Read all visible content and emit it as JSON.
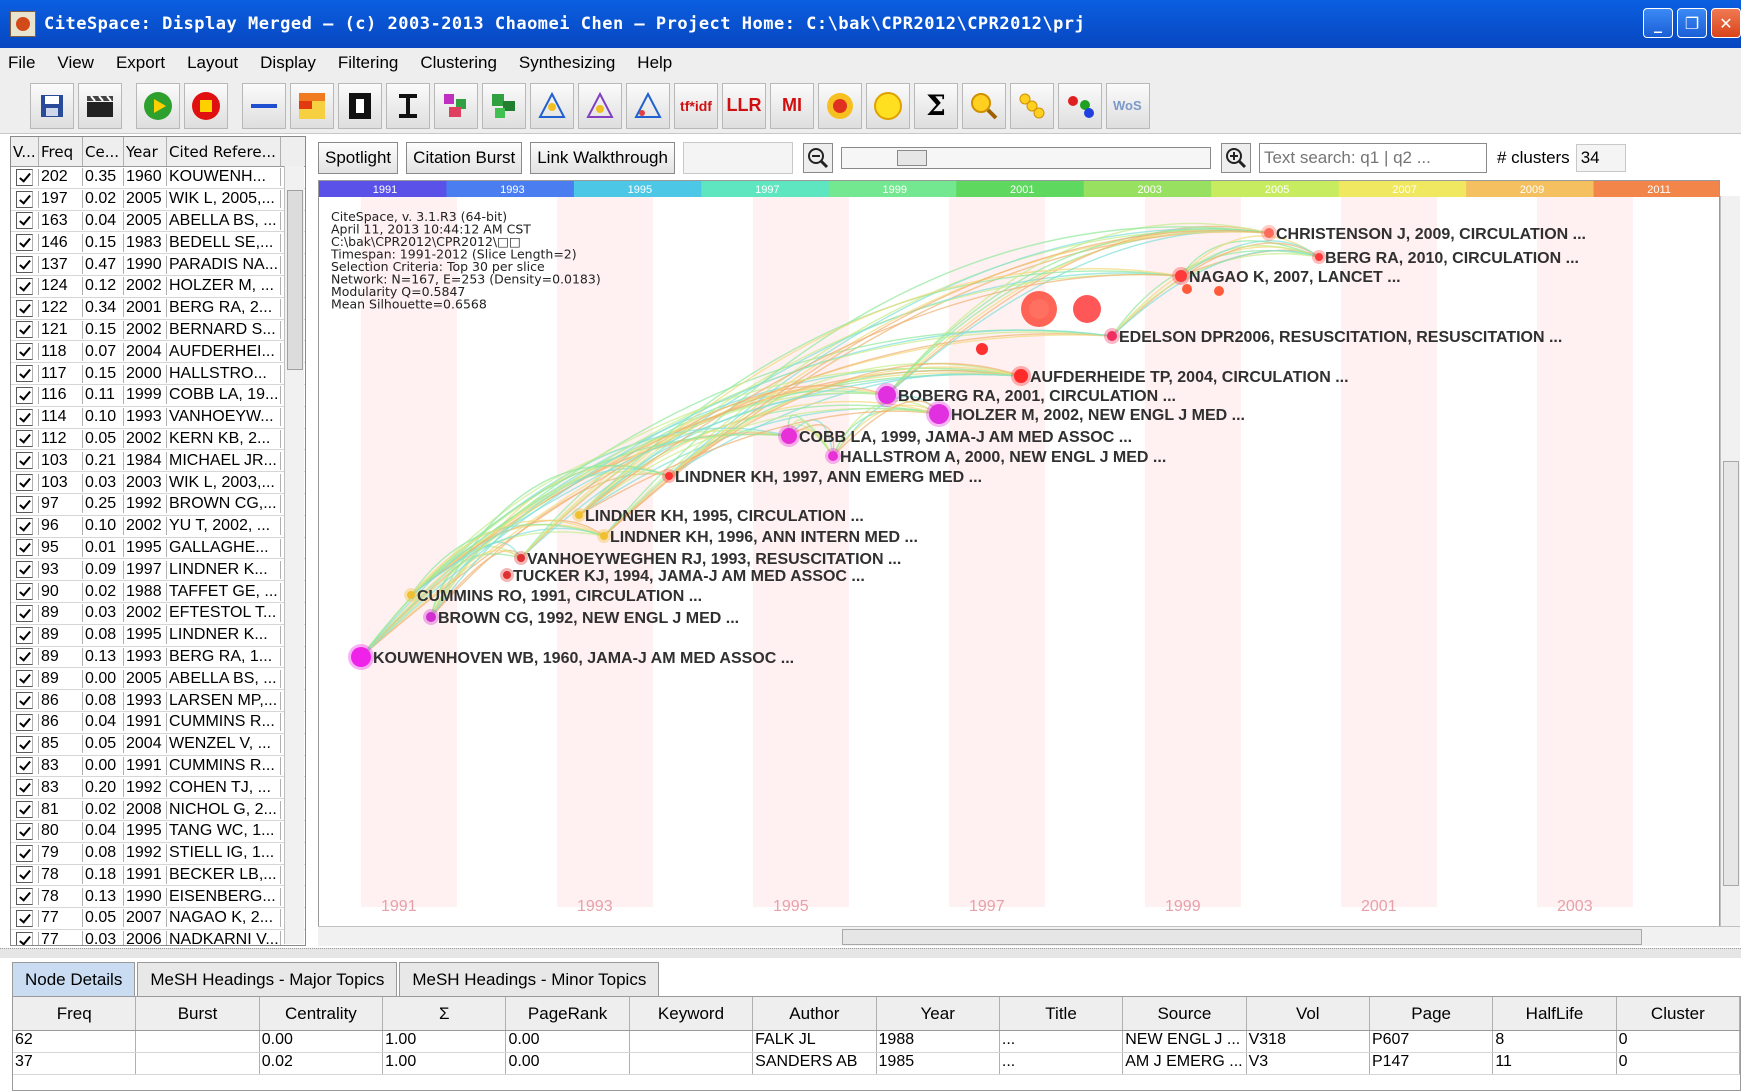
{
  "window": {
    "title": "CiteSpace: Display Merged – (c) 2003-2013 Chaomei Chen – Project Home: C:\\bak\\CPR2012\\CPR2012\\prj",
    "buttons": [
      "_",
      "❐",
      "✕"
    ]
  },
  "menu": [
    "File",
    "View",
    "Export",
    "Layout",
    "Display",
    "Filtering",
    "Clustering",
    "Synthesizing",
    "Help"
  ],
  "toolbar": {
    "text_buttons": [
      "tf*idf",
      "LLR",
      "MI"
    ],
    "icons": [
      "save-icon",
      "movie-clapper-icon",
      "play-icon",
      "stop-icon",
      "line-icon",
      "grid-colors-icon",
      "i-beam-bold-icon",
      "i-beam-icon",
      "cluster-color-icon",
      "cluster-green-icon",
      "triangle-a-icon",
      "triangle-b-icon",
      "triangle-c-icon",
      "circle-target-icon",
      "circle-yellow-icon",
      "sigma-icon",
      "magnify-yellow-icon",
      "chain-icon",
      "dots-color-icon",
      "wos-icon"
    ]
  },
  "left_table": {
    "headers": [
      "V...",
      "Freq",
      "Ce...",
      "Year",
      "Cited Refere..."
    ],
    "rows": [
      [
        "202",
        "0.35",
        "1960",
        "KOUWENH..."
      ],
      [
        "197",
        "0.02",
        "2005",
        "WIK L, 2005,..."
      ],
      [
        "163",
        "0.04",
        "2005",
        "ABELLA BS, ..."
      ],
      [
        "146",
        "0.15",
        "1983",
        "BEDELL SE,..."
      ],
      [
        "137",
        "0.47",
        "1990",
        "PARADIS NA..."
      ],
      [
        "124",
        "0.12",
        "2002",
        "HOLZER M, ..."
      ],
      [
        "122",
        "0.34",
        "2001",
        "BERG RA, 2..."
      ],
      [
        "121",
        "0.15",
        "2002",
        "BERNARD S..."
      ],
      [
        "118",
        "0.07",
        "2004",
        "AUFDERHEI..."
      ],
      [
        "117",
        "0.15",
        "2000",
        "HALLSTRO..."
      ],
      [
        "116",
        "0.11",
        "1999",
        "COBB LA, 19..."
      ],
      [
        "114",
        "0.10",
        "1993",
        "VANHOEYW..."
      ],
      [
        "112",
        "0.05",
        "2002",
        "KERN KB, 2..."
      ],
      [
        "103",
        "0.21",
        "1984",
        "MICHAEL JR..."
      ],
      [
        "103",
        "0.03",
        "2003",
        "WIK L, 2003,..."
      ],
      [
        "97",
        "0.25",
        "1992",
        "BROWN CG,..."
      ],
      [
        "96",
        "0.10",
        "2002",
        "YU T, 2002, ..."
      ],
      [
        "95",
        "0.01",
        "1995",
        "GALLAGHE..."
      ],
      [
        "93",
        "0.09",
        "1997",
        "LINDNER K..."
      ],
      [
        "90",
        "0.02",
        "1988",
        "TAFFET GE, ..."
      ],
      [
        "89",
        "0.03",
        "2002",
        "EFTESTOL T..."
      ],
      [
        "89",
        "0.08",
        "1995",
        "LINDNER K..."
      ],
      [
        "89",
        "0.13",
        "1993",
        "BERG RA, 1..."
      ],
      [
        "89",
        "0.00",
        "2005",
        "ABELLA BS, ..."
      ],
      [
        "86",
        "0.08",
        "1993",
        "LARSEN MP,..."
      ],
      [
        "86",
        "0.04",
        "1991",
        "CUMMINS R..."
      ],
      [
        "85",
        "0.05",
        "2004",
        "WENZEL V, ..."
      ],
      [
        "83",
        "0.00",
        "1991",
        "CUMMINS R..."
      ],
      [
        "83",
        "0.20",
        "1992",
        "COHEN TJ, ..."
      ],
      [
        "81",
        "0.02",
        "2008",
        "NICHOL G, 2..."
      ],
      [
        "80",
        "0.04",
        "1995",
        "TANG WC, 1..."
      ],
      [
        "79",
        "0.08",
        "1992",
        "STIELL IG, 1..."
      ],
      [
        "78",
        "0.18",
        "1991",
        "BECKER LB,..."
      ],
      [
        "78",
        "0.13",
        "1990",
        "EISENBERG..."
      ],
      [
        "77",
        "0.05",
        "2007",
        "NAGAO K, 2..."
      ],
      [
        "77",
        "0.03",
        "2006",
        "NADKARNI V..."
      ]
    ]
  },
  "controls": {
    "spotlight": "Spotlight",
    "citation_burst": "Citation Burst",
    "link_walkthrough": "Link Walkthrough",
    "search_placeholder": "Text search: q1 | q2 ...",
    "clusters_label": "# clusters",
    "clusters_value": "34"
  },
  "timeline_band": {
    "years": [
      "1991",
      "1993",
      "1995",
      "1997",
      "1999",
      "2001",
      "2003",
      "2005",
      "2007",
      "2009",
      "2011"
    ],
    "colors": [
      "#5a52e8",
      "#4a7ef0",
      "#4cc8e6",
      "#5de6c0",
      "#74e890",
      "#5fd860",
      "#98e060",
      "#c8ec60",
      "#f0e860",
      "#f4c060",
      "#f2864a"
    ]
  },
  "info": [
    "CiteSpace, v. 3.1.R3 (64-bit)",
    "April 11, 2013 10:44:12 AM CST",
    "C:\\bak\\CPR2012\\CPR2012\\□□",
    "Timespan: 1991-2012 (Slice Length=2)",
    "Selection Criteria: Top 30 per slice",
    "Network: N=167, E=253 (Density=0.0183)",
    "Modularity Q=0.5847",
    "Mean Silhouette=0.6568"
  ],
  "year_axis": [
    "1991",
    "1993",
    "1995",
    "1997",
    "1999",
    "2001",
    "2003",
    "2005",
    "2007",
    "2009",
    "2011"
  ],
  "nodes": [
    {
      "label": "CHRISTENSON J, 2009, CIRCULATION ...",
      "color": "#ff6a5a"
    },
    {
      "label": "BERG RA, 2010, CIRCULATION ...",
      "color": "#ff3a3a"
    },
    {
      "label": "NAGAO K, 2007, LANCET ...",
      "color": "#ff3a3a"
    },
    {
      "label": "EDELSON DPR2006, RESUSCITATION, RESUSCITATION ...",
      "color": "#ee3060"
    },
    {
      "label": "AUFDERHEIDE TP, 2004, CIRCULATION ...",
      "color": "#ff2a2a"
    },
    {
      "label": "BOBERG RA, 2001, CIRCULATION ...",
      "color": "#e030e0"
    },
    {
      "label": "HOLZER M, 2002, NEW ENGL J MED ...",
      "color": "#e030e0"
    },
    {
      "label": "COBB LA, 1999, JAMA-J AM MED ASSOC ...",
      "color": "#e830d8"
    },
    {
      "label": "HALLSTROM A, 2000, NEW ENGL J MED ...",
      "color": "#e830d8"
    },
    {
      "label": "LINDNER KH, 1997, ANN EMERG MED ...",
      "color": "#ff3030"
    },
    {
      "label": "LINDNER KH, 1995, CIRCULATION ...",
      "color": "#f0c030"
    },
    {
      "label": "LINDNER KH, 1996, ANN INTERN MED ...",
      "color": "#f0c030"
    },
    {
      "label": "VANHOEYWEGHEN RJ, 1993, RESUSCITATION ...",
      "color": "#e03030"
    },
    {
      "label": "TUCKER KJ, 1994, JAMA-J AM MED ASSOC ...",
      "color": "#e03030"
    },
    {
      "label": "CUMMINS RO, 1991, CIRCULATION ...",
      "color": "#f0c030"
    },
    {
      "label": "BROWN CG, 1992, NEW ENGL J MED ...",
      "color": "#d030d0"
    },
    {
      "label": "KOUWENHOVEN WB, 1960, JAMA-J AM MED ASSOC ...",
      "color": "#ee22e8"
    }
  ],
  "bottom_tabs": [
    "Node Details",
    "MeSH Headings - Major Topics",
    "MeSH Headings - Minor Topics"
  ],
  "bottom_table": {
    "headers": [
      "Freq",
      "Burst",
      "Centrality",
      "Σ",
      "PageRank",
      "Keyword",
      "Author",
      "Year",
      "Title",
      "Source",
      "Vol",
      "Page",
      "HalfLife",
      "Cluster"
    ],
    "rows": [
      [
        "62",
        "",
        "0.00",
        "1.00",
        "0.00",
        "",
        "FALK JL",
        "1988",
        "...",
        "NEW ENGL J ...",
        "V318",
        "P607",
        "8",
        "0"
      ],
      [
        "37",
        "",
        "0.02",
        "1.00",
        "0.00",
        "",
        "SANDERS AB",
        "1985",
        "...",
        "AM J EMERG ...",
        "V3",
        "P147",
        "11",
        "0"
      ]
    ]
  }
}
